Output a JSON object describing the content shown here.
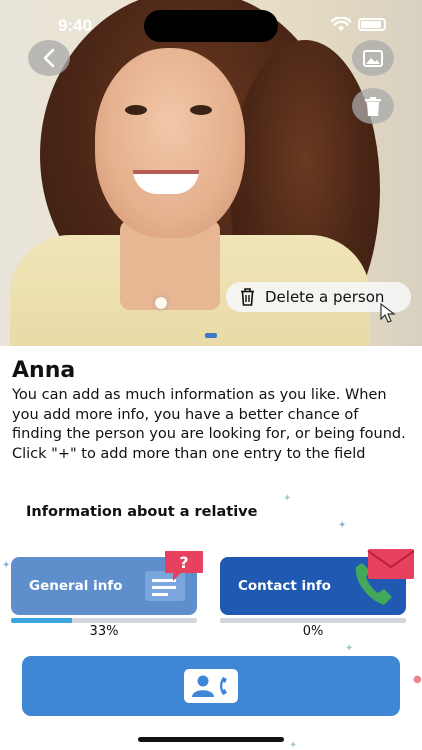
{
  "status_bar": {
    "time": "9:40"
  },
  "photo": {
    "icons": [
      "back-icon",
      "image-icon",
      "trash-icon"
    ]
  },
  "delete_action": {
    "label": "Delete a person",
    "icon": "trash-icon"
  },
  "person": {
    "name": "Anna",
    "description": "You can add as much information as you like. When you add more info, you have a better chance of finding the person you are looking for, or being found. Click \"+\" to add more than one entry to the field"
  },
  "section": {
    "title": "Information about a relative"
  },
  "cards": {
    "general": {
      "label": "General info",
      "progress_text": "33%",
      "progress": 0.33,
      "color": "#5f8ecd",
      "icon": "question-doc-icon"
    },
    "contact": {
      "label": "Contact info",
      "progress_text": "0%",
      "progress": 0.0,
      "color": "#2059b1",
      "icon": "phone-mail-icon"
    }
  },
  "bottom_action": {
    "icon": "contact-card-phone-icon",
    "color": "#3f86d4"
  },
  "colors": {
    "accent": "#3f86d4",
    "progress": "#3aa5dc"
  }
}
